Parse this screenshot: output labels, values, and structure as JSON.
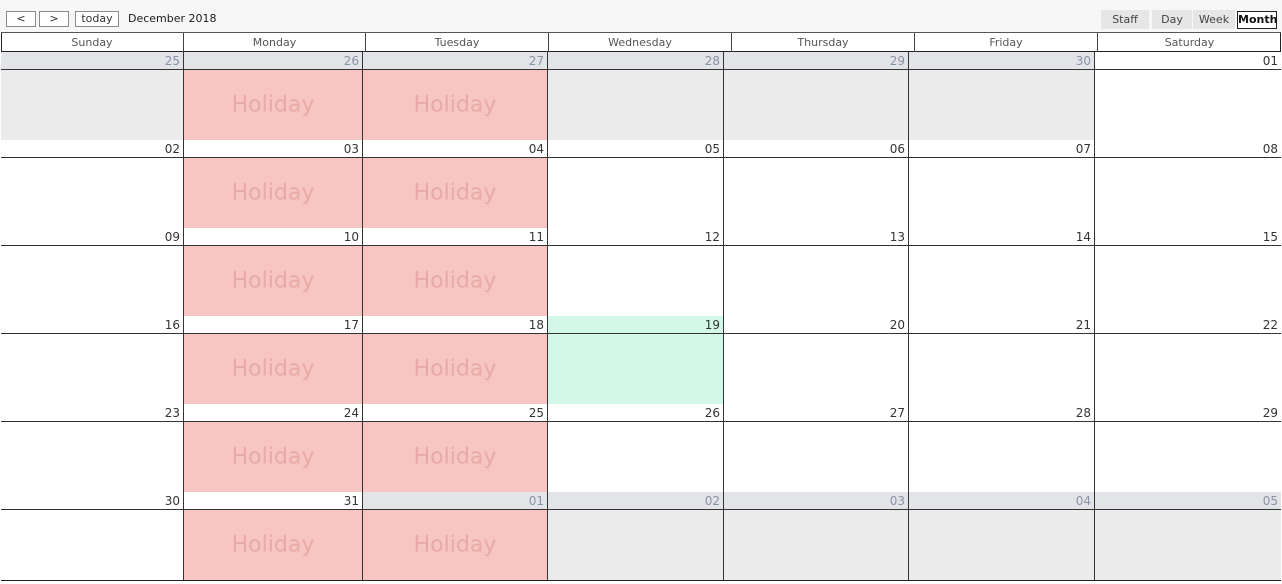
{
  "toolbar": {
    "prev_label": "<",
    "next_label": ">",
    "today_label": "today",
    "period_title": "December 2018",
    "views": [
      "Staff",
      "Day",
      "Week",
      "Month"
    ],
    "active_view": "Month"
  },
  "weekdays": [
    "Sunday",
    "Monday",
    "Tuesday",
    "Wednesday",
    "Thursday",
    "Friday",
    "Saturday"
  ],
  "event_label": "Holiday",
  "colors": {
    "holiday_bg": "#f8c6c2",
    "today_bg": "#d4f8e8",
    "other_month_bg": "#ebebeb"
  },
  "weeks": [
    {
      "days": [
        {
          "day": "25",
          "other": true
        },
        {
          "day": "26",
          "other": true,
          "holiday": true
        },
        {
          "day": "27",
          "other": true,
          "holiday": true
        },
        {
          "day": "28",
          "other": true
        },
        {
          "day": "29",
          "other": true
        },
        {
          "day": "30",
          "other": true
        },
        {
          "day": "01"
        }
      ]
    },
    {
      "days": [
        {
          "day": "02"
        },
        {
          "day": "03",
          "holiday": true
        },
        {
          "day": "04",
          "holiday": true
        },
        {
          "day": "05"
        },
        {
          "day": "06"
        },
        {
          "day": "07"
        },
        {
          "day": "08"
        }
      ]
    },
    {
      "days": [
        {
          "day": "09"
        },
        {
          "day": "10",
          "holiday": true
        },
        {
          "day": "11",
          "holiday": true
        },
        {
          "day": "12"
        },
        {
          "day": "13"
        },
        {
          "day": "14"
        },
        {
          "day": "15"
        }
      ]
    },
    {
      "days": [
        {
          "day": "16"
        },
        {
          "day": "17",
          "holiday": true
        },
        {
          "day": "18",
          "holiday": true
        },
        {
          "day": "19",
          "today": true
        },
        {
          "day": "20"
        },
        {
          "day": "21"
        },
        {
          "day": "22"
        }
      ]
    },
    {
      "days": [
        {
          "day": "23"
        },
        {
          "day": "24",
          "holiday": true
        },
        {
          "day": "25",
          "holiday": true
        },
        {
          "day": "26"
        },
        {
          "day": "27"
        },
        {
          "day": "28"
        },
        {
          "day": "29"
        }
      ]
    },
    {
      "days": [
        {
          "day": "30"
        },
        {
          "day": "31",
          "holiday": true
        },
        {
          "day": "01",
          "other": true,
          "holiday": true
        },
        {
          "day": "02",
          "other": true
        },
        {
          "day": "03",
          "other": true
        },
        {
          "day": "04",
          "other": true
        },
        {
          "day": "05",
          "other": true
        }
      ]
    }
  ]
}
